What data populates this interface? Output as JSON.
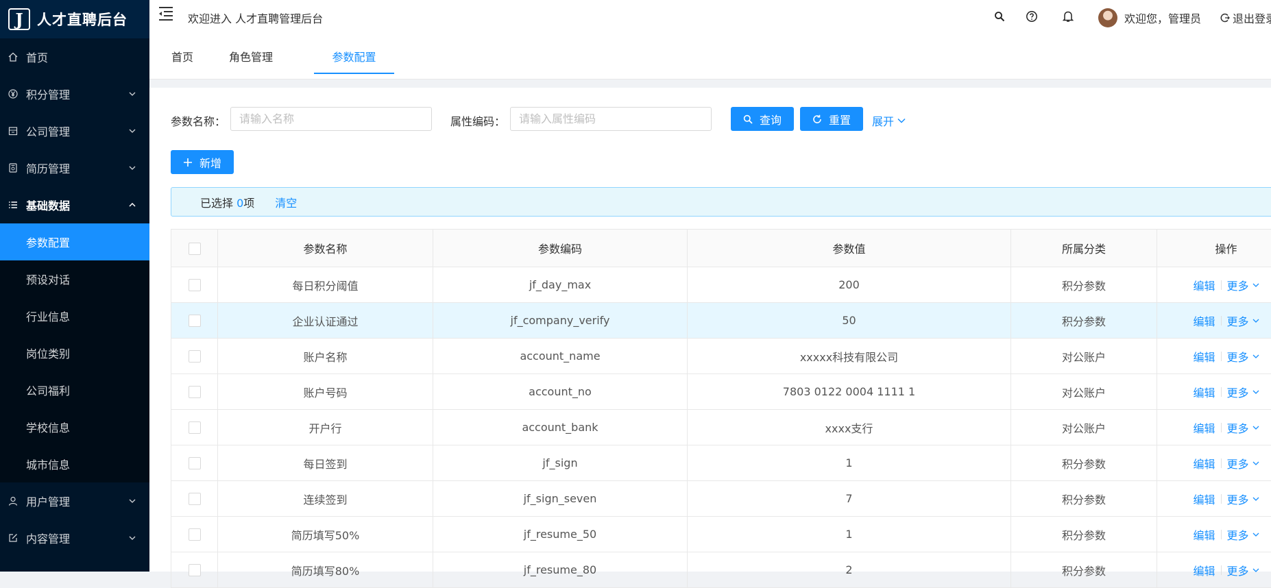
{
  "app": {
    "logo_letter": "J",
    "title": "人才直聘后台"
  },
  "sidebar": {
    "items": [
      {
        "label": "首页",
        "icon": "home-icon",
        "has_arrow": false
      },
      {
        "label": "积分管理",
        "icon": "yen-icon",
        "has_arrow": true
      },
      {
        "label": "公司管理",
        "icon": "building-icon",
        "has_arrow": true
      },
      {
        "label": "简历管理",
        "icon": "resume-icon",
        "has_arrow": true
      },
      {
        "label": "基础数据",
        "icon": "list-icon",
        "has_arrow": true,
        "open": true
      },
      {
        "label": "用户管理",
        "icon": "user-icon",
        "has_arrow": true
      },
      {
        "label": "内容管理",
        "icon": "edit-icon",
        "has_arrow": true
      }
    ],
    "sub_items": [
      "参数配置",
      "预设对话",
      "行业信息",
      "岗位类别",
      "公司福利",
      "学校信息",
      "城市信息"
    ],
    "active_sub": 0
  },
  "header": {
    "welcome": "欢迎进入 人才直聘管理后台",
    "user_greeting": "欢迎您，管理员",
    "logout": "退出登录"
  },
  "tabs": [
    {
      "label": "首页"
    },
    {
      "label": "角色管理"
    },
    {
      "label": "参数配置",
      "active": true
    }
  ],
  "search": {
    "name_label": "参数名称：",
    "name_placeholder": "请输入名称",
    "code_label": "属性编码：",
    "code_placeholder": "请输入属性编码",
    "query_label": "查询",
    "reset_label": "重置",
    "expand_label": "展开",
    "add_label": "新增"
  },
  "selection": {
    "prefix": "已选择 ",
    "count": "0",
    "suffix": "项",
    "clear": "清空"
  },
  "table": {
    "columns": [
      "参数名称",
      "参数编码",
      "参数值",
      "所属分类",
      "操作"
    ],
    "rows": [
      {
        "name": "每日积分阈值",
        "code": "jf_day_max",
        "value": "200",
        "category": "积分参数"
      },
      {
        "name": "企业认证通过",
        "code": "jf_company_verify",
        "value": "50",
        "category": "积分参数"
      },
      {
        "name": "账户名称",
        "code": "account_name",
        "value": "xxxxx科技有限公司",
        "category": "对公账户"
      },
      {
        "name": "账户号码",
        "code": "account_no",
        "value": "7803 0122 0004 1111 1",
        "category": "对公账户"
      },
      {
        "name": "开户行",
        "code": "account_bank",
        "value": "xxxx支行",
        "category": "对公账户"
      },
      {
        "name": "每日签到",
        "code": "jf_sign",
        "value": "1",
        "category": "积分参数"
      },
      {
        "name": "连续签到",
        "code": "jf_sign_seven",
        "value": "7",
        "category": "积分参数"
      },
      {
        "name": "简历填写50%",
        "code": "jf_resume_50",
        "value": "1",
        "category": "积分参数"
      },
      {
        "name": "简历填写80%",
        "code": "jf_resume_80",
        "value": "2",
        "category": "积分参数"
      }
    ],
    "highlighted_row": 1,
    "edit_label": "编辑",
    "more_label": "更多"
  },
  "colors": {
    "primary": "#1890ff",
    "sidebar_bg": "#001529",
    "sidebar_submenu_bg": "#000c17",
    "row_highlight": "#e6f7ff"
  }
}
